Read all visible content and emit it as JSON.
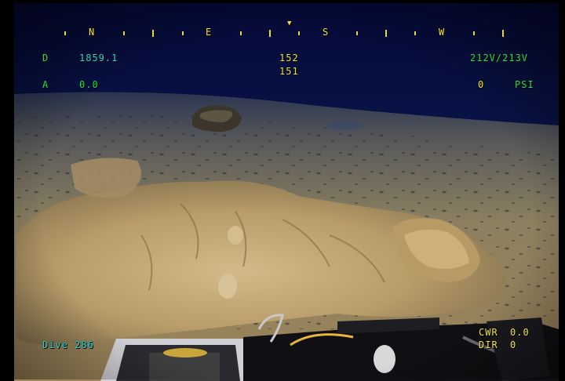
{
  "overlay": {
    "heading_marker": "▼",
    "compass_letters": [
      "N",
      "E",
      "S",
      "W"
    ],
    "depth_label": "D",
    "depth_value": "1859.1",
    "heading_primary": "152",
    "heading_secondary": "151",
    "voltage": "212V/213V",
    "altitude_label": "A",
    "altitude_value": "0.0",
    "pressure_value": "0",
    "pressure_unit": "PSI",
    "dive_label": "Dive 286",
    "cwr_label": "CWR",
    "cwr_value": "0.0",
    "dir_label": "DIR",
    "dir_value": "0"
  },
  "colors": {
    "hud_green": "#21e24a",
    "hud_yellow": "#f2e23a",
    "hud_cyan": "#2ad9d0",
    "water": "#0b1a45",
    "seafloor": "#a88e60"
  }
}
